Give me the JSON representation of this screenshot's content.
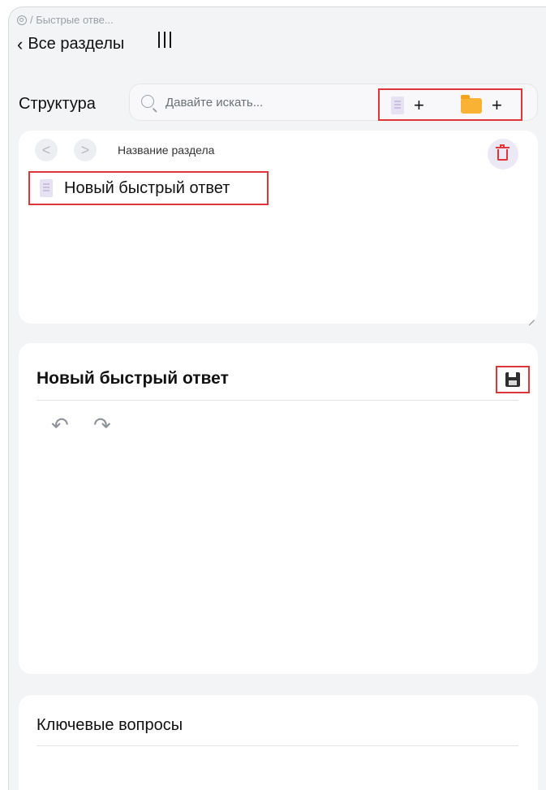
{
  "breadcrumb": {
    "text": "/ Быстрые отве..."
  },
  "back": {
    "label": "Все разделы"
  },
  "structure": {
    "label": "Структура",
    "search_placeholder": "Давайте искать...",
    "add_doc_label": "+",
    "add_folder_label": "+"
  },
  "tree": {
    "section_name_label": "Название раздела",
    "prev_icon": "<",
    "next_icon": ">",
    "item_label": "Новый быстрый ответ"
  },
  "editor": {
    "title": "Новый быстрый ответ",
    "undo_icon": "↶",
    "redo_icon": "↷"
  },
  "key_questions": {
    "title": "Ключевые вопросы"
  },
  "colors": {
    "accent_red": "#e0363a",
    "folder": "#f9b233"
  }
}
